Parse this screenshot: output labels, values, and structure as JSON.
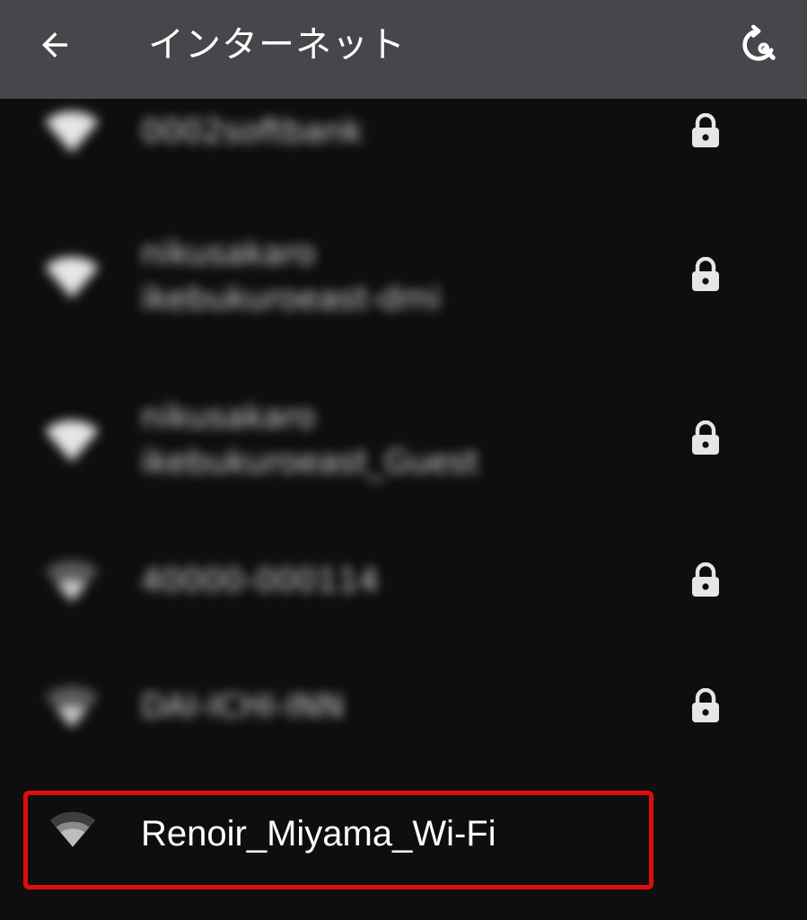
{
  "appbar": {
    "title": "インターネット",
    "back_icon": "arrow-back-icon",
    "refresh_icon": "refresh-icon"
  },
  "networks": [
    {
      "ssid_line1": "0002softbank",
      "ssid_line2": "",
      "locked": true,
      "signal": "full"
    },
    {
      "ssid_line1": "nikusakaro",
      "ssid_line2": "ikebukuroeast-dmi",
      "locked": true,
      "signal": "full"
    },
    {
      "ssid_line1": "nikusakaro",
      "ssid_line2": "ikebukuroeast_Guest",
      "locked": true,
      "signal": "full"
    },
    {
      "ssid_line1": "40000-000114",
      "ssid_line2": "",
      "locked": true,
      "signal": "weak"
    },
    {
      "ssid_line1": "DAI-ICHI-INN",
      "ssid_line2": "",
      "locked": true,
      "signal": "weak"
    }
  ],
  "highlighted_network": {
    "ssid": "Renoir_Miyama_Wi-Fi",
    "locked": false,
    "signal": "medium"
  },
  "colors": {
    "appbar_bg": "#47464a",
    "background": "#0e0e0f",
    "highlight_border": "#e10c0c"
  }
}
